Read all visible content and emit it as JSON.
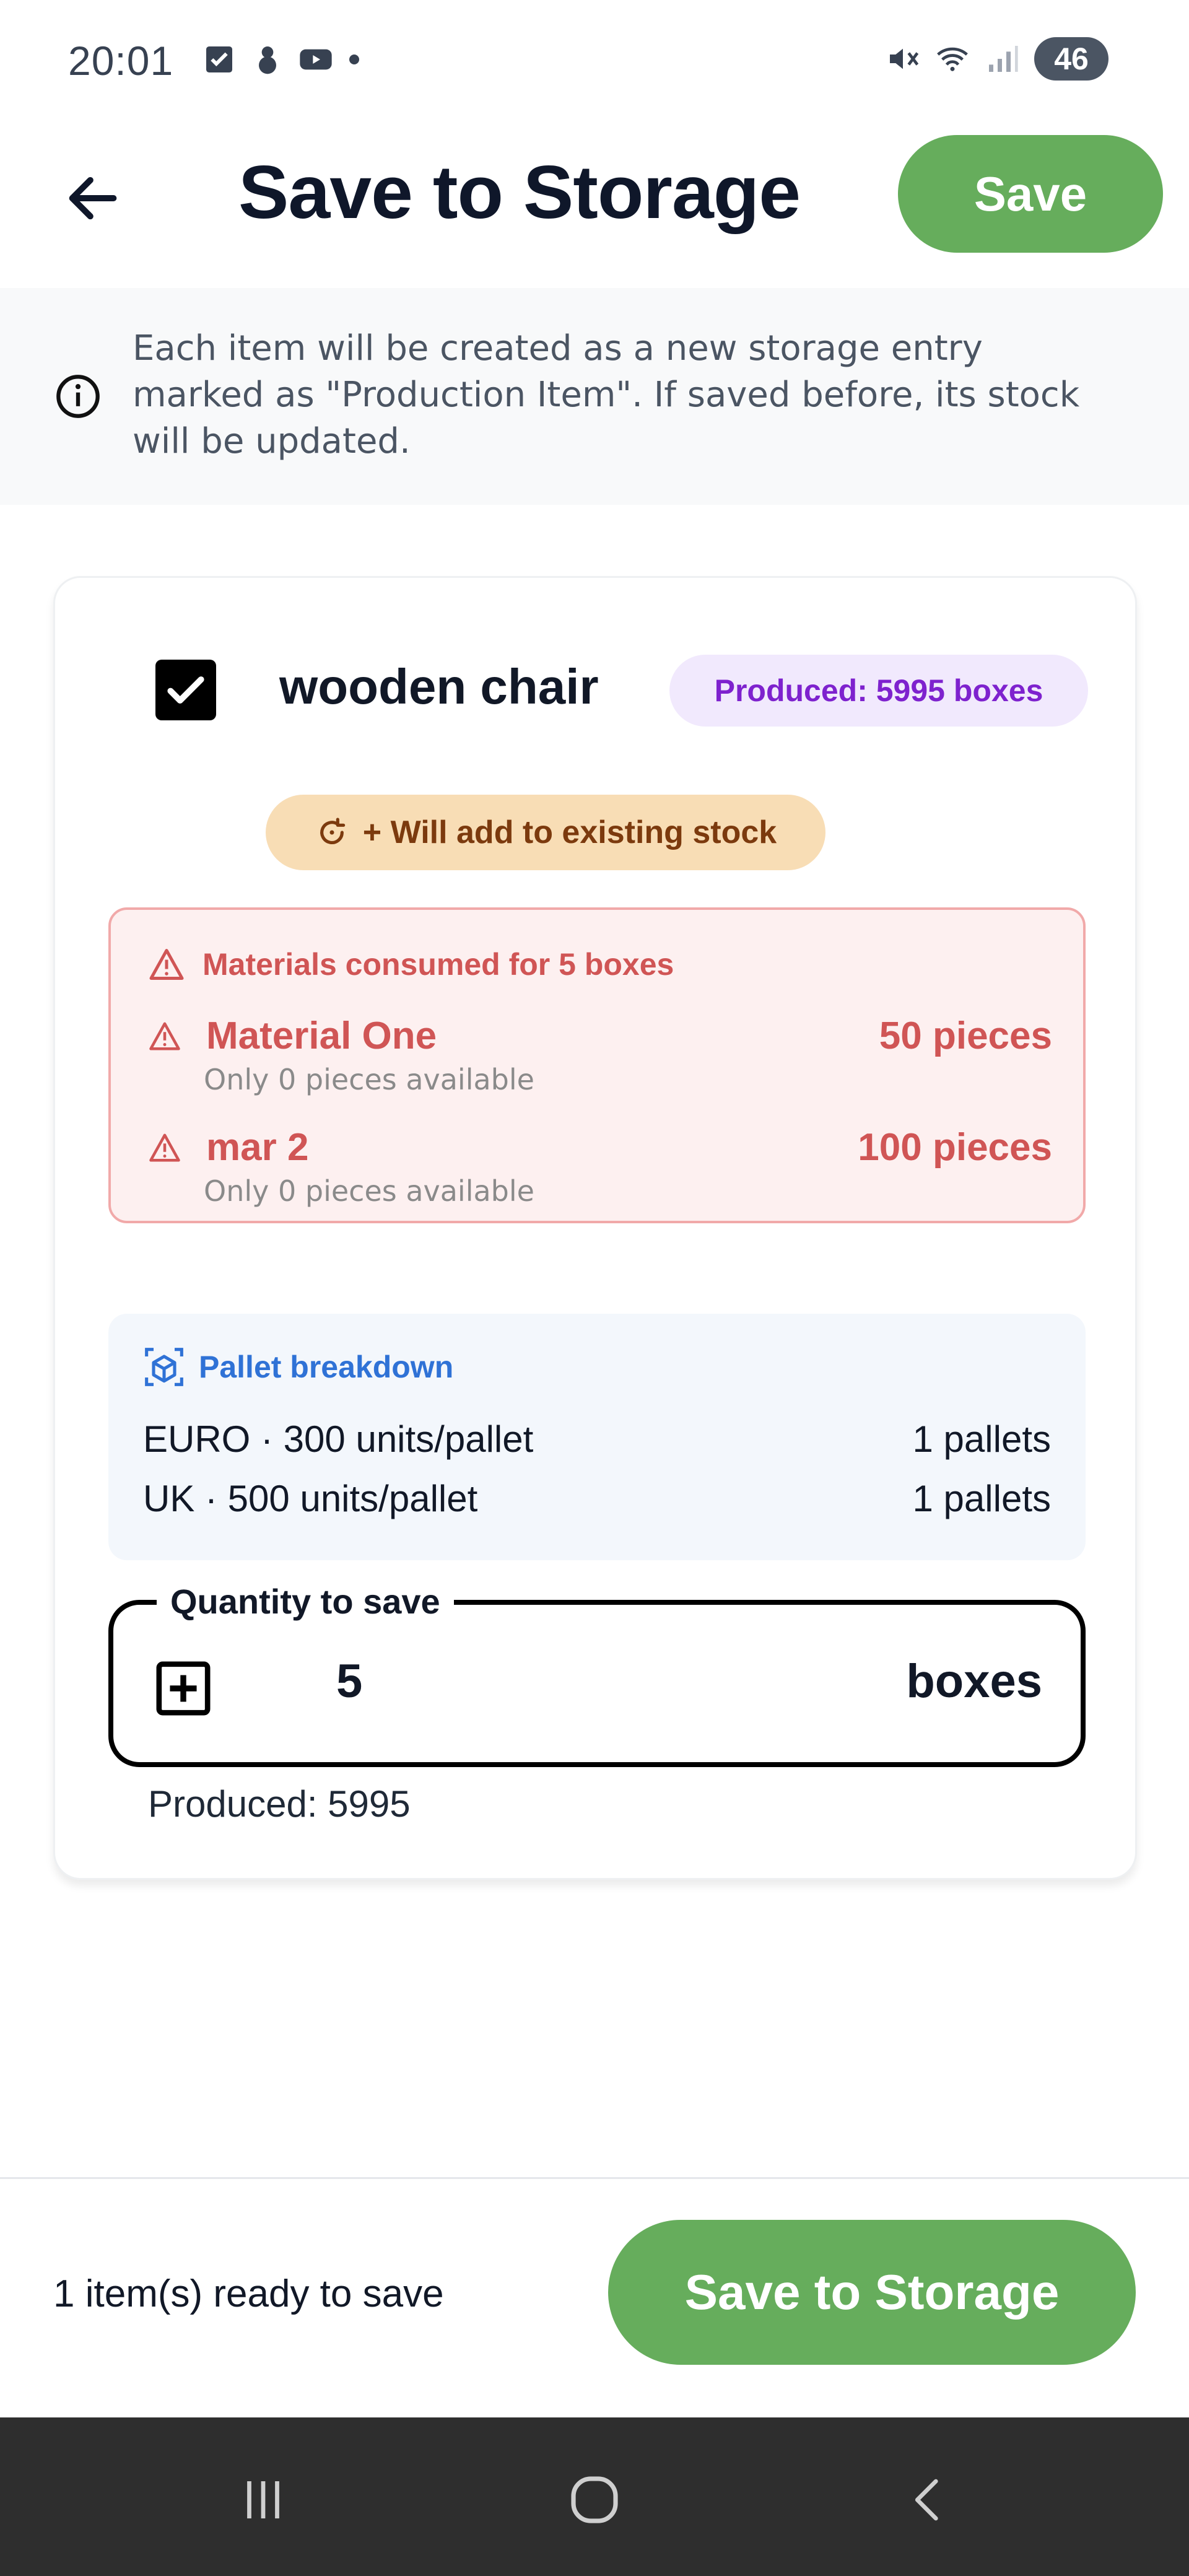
{
  "status_bar": {
    "time": "20:01",
    "battery": "46"
  },
  "header": {
    "title": "Save to Storage",
    "save_label": "Save"
  },
  "info": {
    "text": "Each item will be created as a new storage entry marked as \"Production Item\". If saved before, its stock will be updated."
  },
  "item": {
    "checked": true,
    "name": "wooden chair",
    "produced_badge": "Produced: 5995 boxes",
    "stock_chip": "+ Will add to existing stock",
    "materials": {
      "header": "Materials consumed for 5 boxes",
      "rows": [
        {
          "name": "Material One",
          "amount": "50 pieces",
          "availability": "Only 0 pieces available"
        },
        {
          "name": "mar 2",
          "amount": "100 pieces",
          "availability": "Only 0 pieces available"
        }
      ]
    },
    "pallets": {
      "header": "Pallet breakdown",
      "rows": [
        {
          "label": "EURO · 300 units/pallet",
          "count": "1 pallets"
        },
        {
          "label": "UK · 500 units/pallet",
          "count": "1 pallets"
        }
      ]
    },
    "quantity": {
      "label": "Quantity to save",
      "value": "5",
      "unit": "boxes"
    },
    "produced_note": "Produced: 5995"
  },
  "footer": {
    "ready_text": "1 item(s) ready to save",
    "save_button": "Save to Storage"
  },
  "colors": {
    "accent_green": "#66ad5c",
    "warning_red": "#d05555",
    "info_blue": "#2f72d6",
    "badge_purple": "#7e22ce"
  }
}
